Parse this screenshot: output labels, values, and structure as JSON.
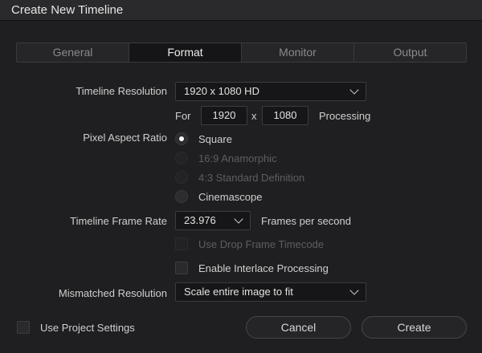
{
  "window": {
    "title": "Create New Timeline"
  },
  "tabs": [
    {
      "label": "General",
      "active": false
    },
    {
      "label": "Format",
      "active": true
    },
    {
      "label": "Monitor",
      "active": false
    },
    {
      "label": "Output",
      "active": false
    }
  ],
  "resolution": {
    "label": "Timeline Resolution",
    "selected": "1920 x 1080 HD",
    "for_label": "For",
    "width": "1920",
    "x_label": "x",
    "height": "1080",
    "processing_label": "Processing"
  },
  "pixel_aspect": {
    "label": "Pixel Aspect Ratio",
    "options": [
      {
        "label": "Square",
        "checked": true,
        "enabled": true
      },
      {
        "label": "16:9 Anamorphic",
        "checked": false,
        "enabled": false
      },
      {
        "label": "4:3 Standard Definition",
        "checked": false,
        "enabled": false
      },
      {
        "label": "Cinemascope",
        "checked": false,
        "enabled": true
      }
    ]
  },
  "frame_rate": {
    "label": "Timeline Frame Rate",
    "selected": "23.976",
    "unit": "Frames per second",
    "drop_frame_label": "Use Drop Frame Timecode",
    "drop_frame_checked": false,
    "interlace_label": "Enable Interlace Processing",
    "interlace_checked": false
  },
  "mismatched": {
    "label": "Mismatched Resolution",
    "selected": "Scale entire image to fit"
  },
  "footer": {
    "use_project_label": "Use Project Settings",
    "use_project_checked": false,
    "cancel_label": "Cancel",
    "create_label": "Create"
  },
  "colors": {
    "background": "#1f1f21",
    "field": "#161618",
    "text": "#d4d4d4",
    "disabled_text": "#5e5e60"
  }
}
